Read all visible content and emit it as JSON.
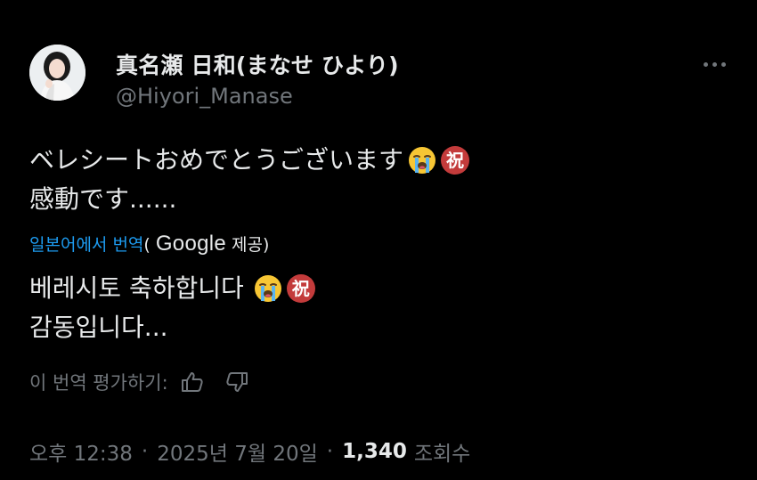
{
  "author": {
    "display_name": "真名瀬 日和(まなせ ひより)",
    "handle": "@Hiyori_Manase"
  },
  "icons": {
    "more": "more-horizontal-icon",
    "avatar": "profile-photo",
    "thumb_up": "thumb-up-icon",
    "thumb_down": "thumb-down-icon",
    "emoji_cry": "loudly-crying-face-emoji",
    "emoji_iwai": "celebration-kanji-emoji"
  },
  "original": {
    "line1": "ベレシートおめでとうございます",
    "line2": "感動です......",
    "emoji_kanji": "祝"
  },
  "translation": {
    "link_label": "일본어에서 번역",
    "paren_open": "(",
    "provider": "Google",
    "provided_suffix": "제공)",
    "line1": "베레시토 축하합니다",
    "line2": "감동입니다...",
    "emoji_kanji": "祝"
  },
  "rating": {
    "label": "이 번역 평가하기:"
  },
  "meta": {
    "time": "오후 12:38",
    "separator": "·",
    "date": "2025년 7월 20일",
    "views_count": "1,340",
    "views_label": "조회수"
  },
  "colors": {
    "background": "#000000",
    "text_primary": "#e7e9ea",
    "text_secondary": "#71767b",
    "link": "#1d9bf0",
    "iwai_badge": "#c33b3b"
  }
}
